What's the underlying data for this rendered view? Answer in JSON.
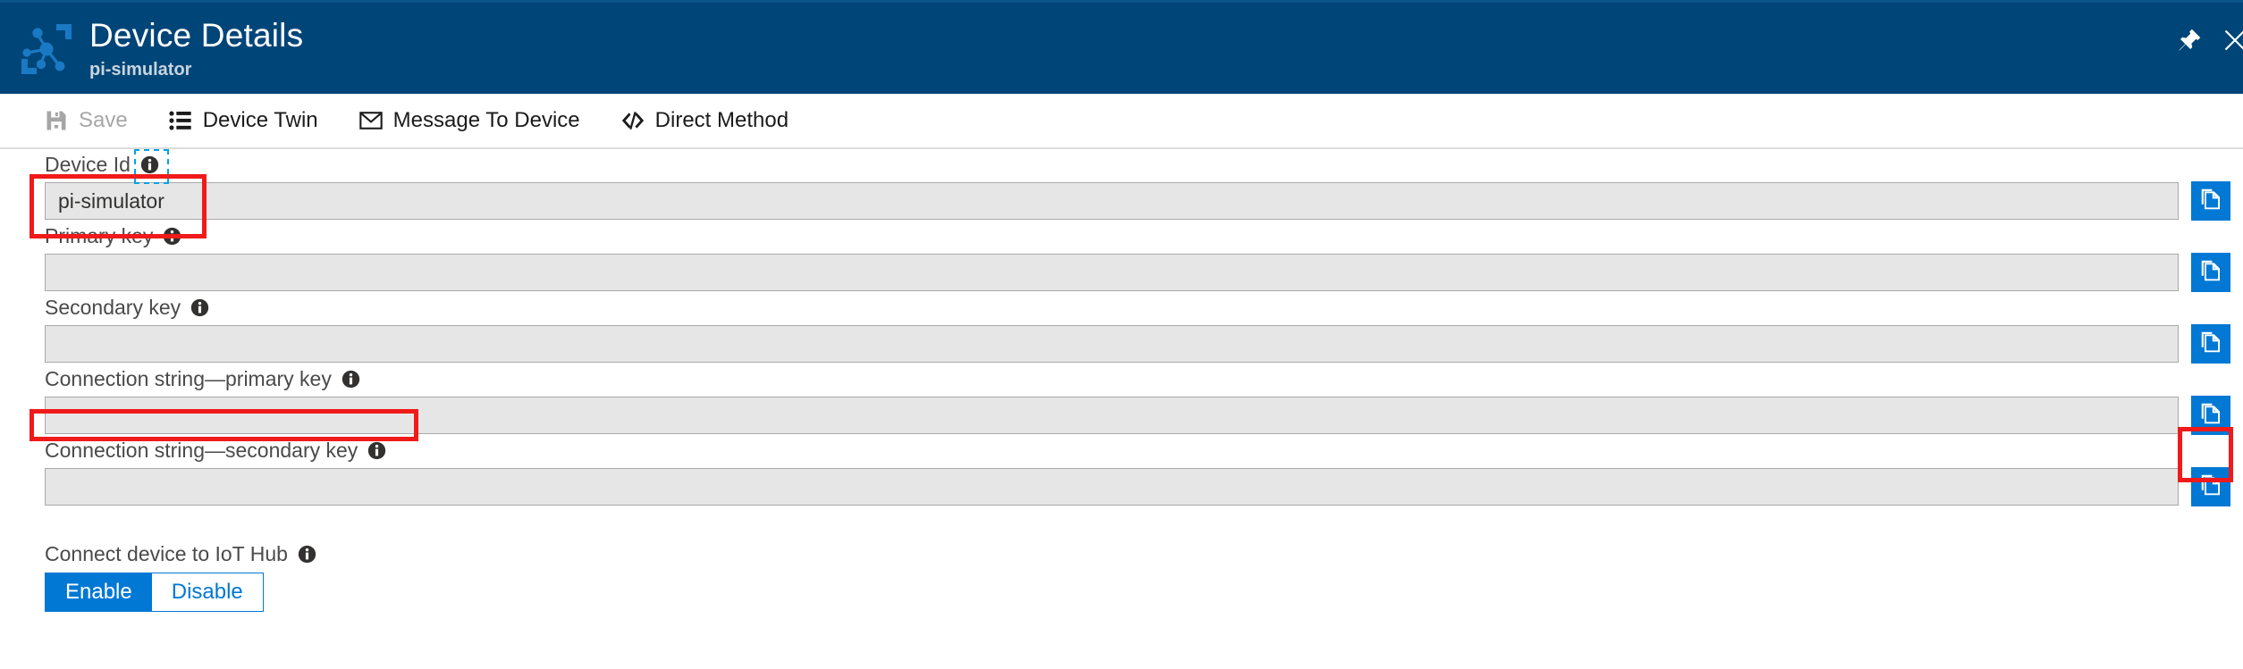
{
  "header": {
    "icon": "iot-device-network-icon",
    "title": "Device Details",
    "subtitle": "pi-simulator",
    "pin_icon": "pin-icon",
    "close_icon": "close-icon",
    "background_color": "#004578"
  },
  "commandbar": {
    "items": [
      {
        "label": "Save",
        "icon": "save-floppy-icon",
        "disabled": true
      },
      {
        "label": "Device Twin",
        "icon": "list-icon",
        "disabled": false
      },
      {
        "label": "Message To Device",
        "icon": "envelope-icon",
        "disabled": false
      },
      {
        "label": "Direct Method",
        "icon": "code-brackets-icon",
        "disabled": false
      }
    ]
  },
  "form": {
    "fields": [
      {
        "label": "Device Id",
        "info_icon": "info-icon",
        "info_focused": true,
        "value": "pi-simulator",
        "placeholder": "",
        "copy_icon": "copy-icon",
        "copy_highlighted": false
      },
      {
        "label": "Primary key",
        "info_icon": "info-icon",
        "info_focused": false,
        "value": "",
        "placeholder": "",
        "copy_icon": "copy-icon",
        "copy_highlighted": false
      },
      {
        "label": "Secondary key",
        "info_icon": "info-icon",
        "info_focused": false,
        "value": "",
        "placeholder": "",
        "copy_icon": "copy-icon",
        "copy_highlighted": false
      },
      {
        "label": "Connection string—primary key",
        "info_icon": "info-icon",
        "info_focused": false,
        "value": "",
        "placeholder": "",
        "copy_icon": "copy-icon",
        "copy_highlighted": true
      },
      {
        "label": "Connection string—secondary key",
        "info_icon": "info-icon",
        "info_focused": false,
        "value": "",
        "placeholder": "",
        "copy_icon": "copy-icon",
        "copy_highlighted": false
      }
    ]
  },
  "connect_toggle": {
    "label": "Connect device to IoT Hub",
    "info_icon": "info-icon",
    "options": [
      {
        "label": "Enable",
        "selected": true
      },
      {
        "label": "Disable",
        "selected": false
      }
    ]
  },
  "annotations": {
    "color": "#f01a1a",
    "boxes": [
      {
        "name": "device-id-highlight"
      },
      {
        "name": "connection-string-primary-key-highlight"
      },
      {
        "name": "copy-connection-string-primary-key-highlight"
      }
    ]
  }
}
